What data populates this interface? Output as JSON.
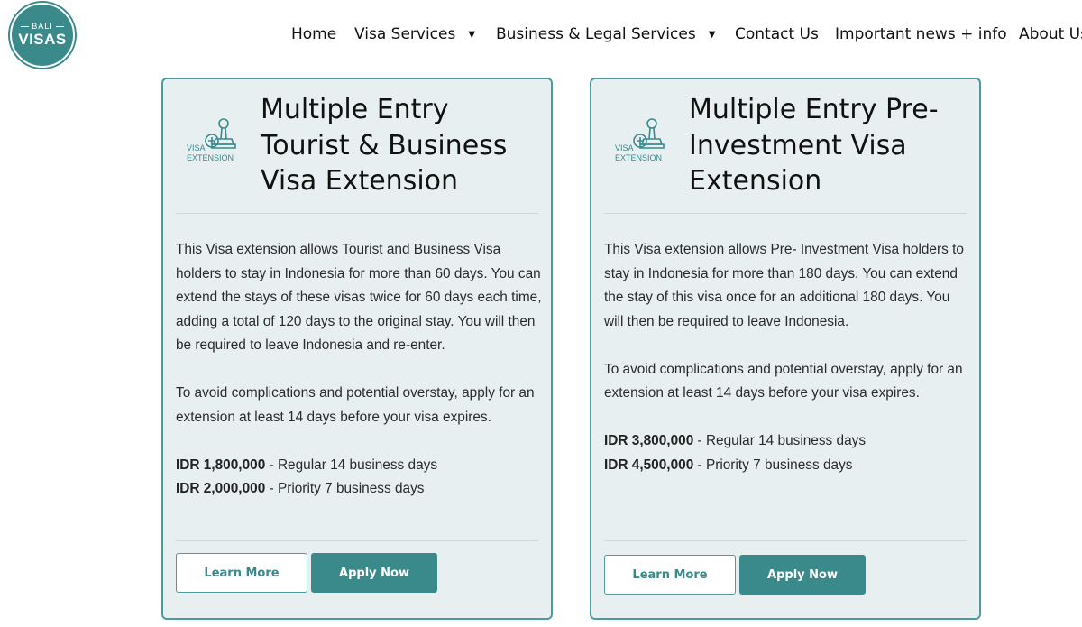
{
  "logo": {
    "small": "BALI",
    "big": "VISAS"
  },
  "nav": [
    {
      "label": "Home",
      "has_dropdown": false
    },
    {
      "label": "Visa Services",
      "has_dropdown": true
    },
    {
      "label": "Business & Legal Services",
      "has_dropdown": true
    },
    {
      "label": "Contact Us",
      "has_dropdown": false
    },
    {
      "label": "Important news + info",
      "has_dropdown": false
    },
    {
      "label": "About Us",
      "has_dropdown": false
    }
  ],
  "colors": {
    "accent": "#3a8a8c",
    "card_bg": "#e7eff0",
    "card_border": "#4f9a9b"
  },
  "cards": [
    {
      "icon_name": "visa-extension-stamp-icon",
      "icon_text": [
        "VISA",
        "EXTENSION"
      ],
      "title": "Multiple Entry Tourist & Business Visa Extension",
      "paragraphs": [
        "This Visa extension allows Tourist and Business Visa holders to stay in Indonesia for more than 60 days. You can extend the stays of these visas twice for 60 days each time, adding a total of 120 days to the original stay. You will then be required to leave Indonesia and re-enter.",
        "To avoid complications and potential overstay, apply for an extension at least 14 days before your visa expires."
      ],
      "prices": [
        {
          "amount": "IDR 1,800,000",
          "desc": " - Regular 14 business days"
        },
        {
          "amount": "IDR 2,000,000",
          "desc": " - Priority 7 business days"
        }
      ],
      "learn_label": "Learn More",
      "apply_label": "Apply Now"
    },
    {
      "icon_name": "visa-extension-stamp-icon",
      "icon_text": [
        "VISA",
        "EXTENSION"
      ],
      "title": "Multiple Entry Pre-Investment Visa Extension",
      "paragraphs": [
        "This Visa extension allows Pre- Investment Visa holders to stay in Indonesia for more than 180 days. You can extend the stay of this visa once for an additional 180 days. You will then be required to leave Indonesia.",
        "To avoid complications and potential overstay, apply for an extension at least 14 days before your visa expires."
      ],
      "prices": [
        {
          "amount": "IDR 3,800,000",
          "desc": " - Regular 14 business days"
        },
        {
          "amount": "IDR 4,500,000",
          "desc": " - Priority 7 business days"
        }
      ],
      "learn_label": "Learn More",
      "apply_label": "Apply Now"
    }
  ]
}
